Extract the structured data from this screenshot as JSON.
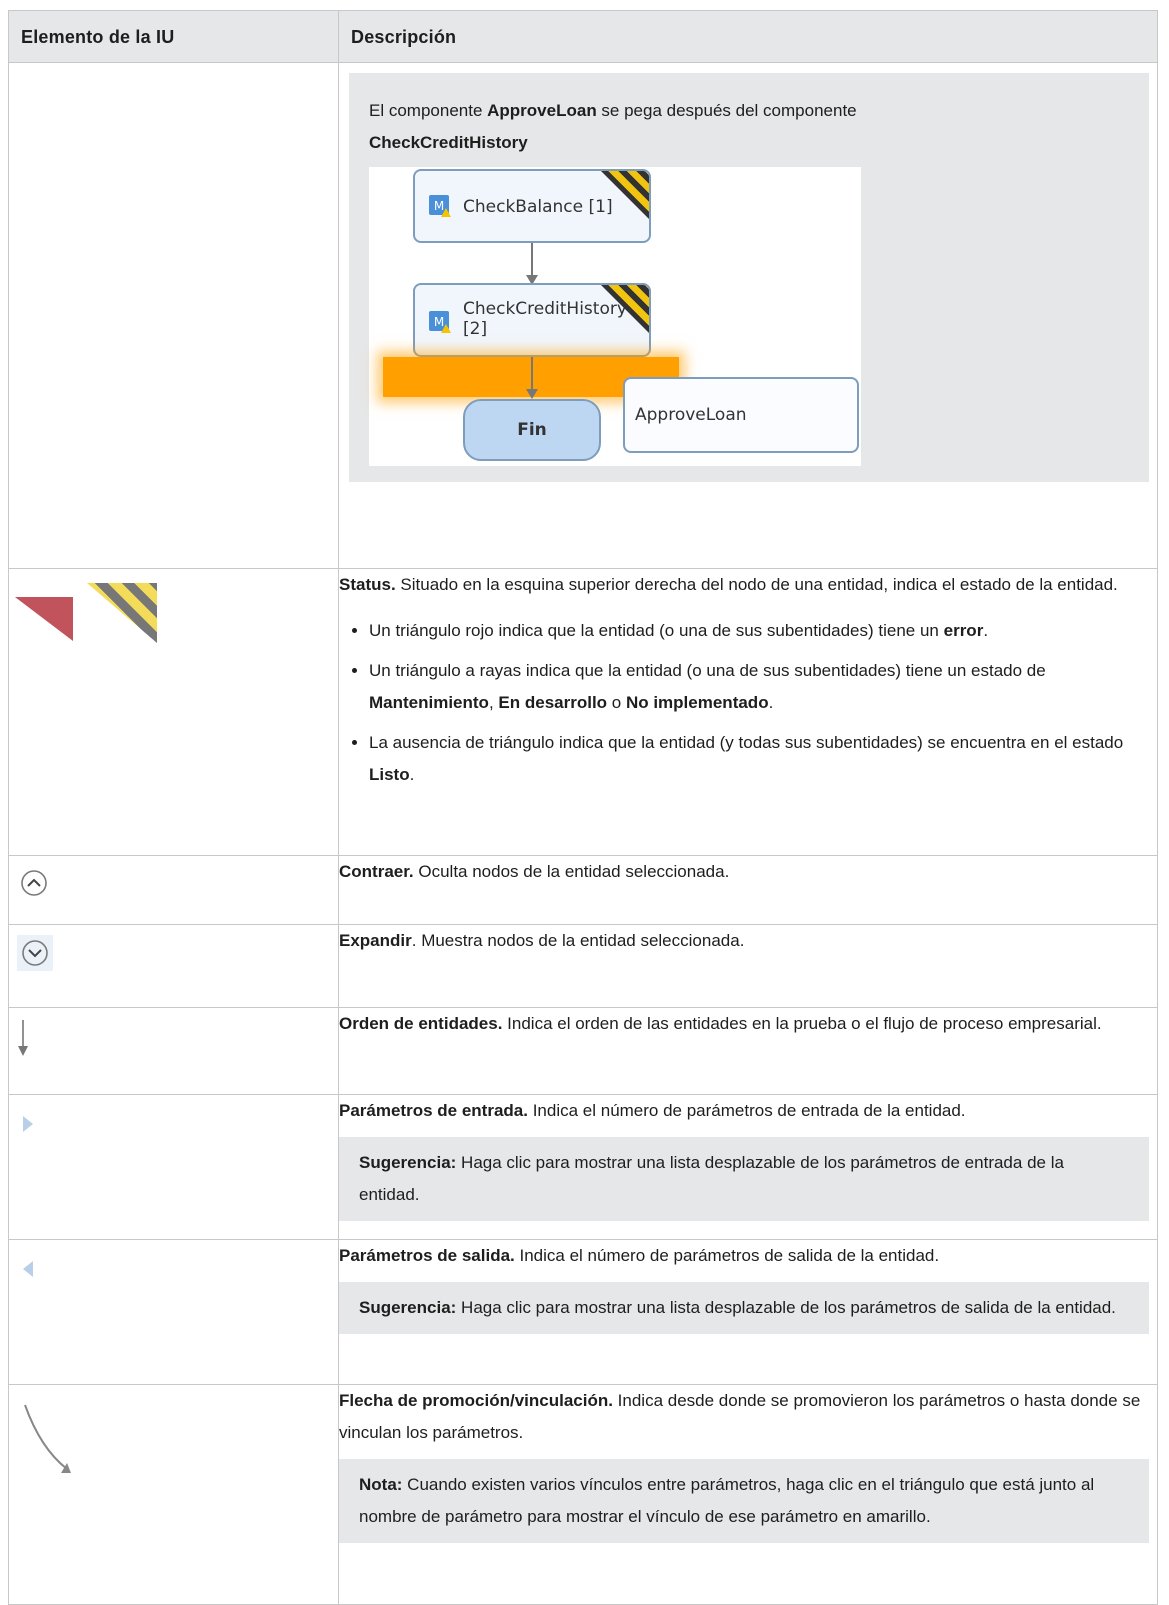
{
  "header": {
    "col1": "Elemento de la IU",
    "col2": "Descripción"
  },
  "row1": {
    "intro_pre": "El componente ",
    "intro_bold1": "ApproveLoan",
    "intro_mid": " se pega después del componente",
    "intro_bold2": "CheckCreditHistory",
    "diagram": {
      "node1": "CheckBalance [1]",
      "node2_line1": "CheckCreditHistory",
      "node2_line2": "[2]",
      "end": "Fin",
      "pasted": "ApproveLoan"
    }
  },
  "status": {
    "title": "Status.",
    "text": " Situado en la esquina superior derecha del nodo de una entidad, indica el estado de la entidad.",
    "b1_pre": "Un triángulo rojo indica que la entidad (o una de sus subentidades) tiene un ",
    "b1_bold": "error",
    "b1_post": ".",
    "b2_pre": "Un triángulo a rayas indica que la entidad (o una de sus subentidades) tiene un estado de ",
    "b2_bold1": "Mantenimiento",
    "b2_sep1": ", ",
    "b2_bold2": "En desarrollo",
    "b2_sep2": " o ",
    "b2_bold3": "No implementado",
    "b2_post": ".",
    "b3_pre": "La ausencia de triángulo indica que la entidad (y todas sus subentidades) se encuentra en el estado ",
    "b3_bold": "Listo",
    "b3_post": "."
  },
  "collapse": {
    "title": "Contraer.",
    "text": " Oculta nodos de la entidad seleccionada."
  },
  "expand": {
    "title": "Expandir",
    "text": ". Muestra nodos de la entidad seleccionada."
  },
  "order": {
    "title": "Orden de entidades.",
    "text": " Indica el orden de las entidades en la prueba o el flujo de proceso empresarial."
  },
  "input": {
    "title": "Parámetros de entrada.",
    "text": " Indica el número de parámetros de entrada de la entidad.",
    "tip_label": "Sugerencia:",
    "tip_text": " Haga clic para mostrar una lista desplazable de los parámetros de entrada de la entidad."
  },
  "output": {
    "title": "Parámetros de salida.",
    "text": " Indica el número de parámetros de salida de la entidad.",
    "tip_label": "Sugerencia:",
    "tip_text": " Haga clic para mostrar una lista desplazable de los parámetros de salida de la entidad."
  },
  "link": {
    "title": "Flecha de promoción/vinculación.",
    "text": " Indica desde donde se promovieron los parámetros o hasta donde se vinculan los parámetros.",
    "note_label": "Nota:",
    "note_text": " Cuando existen varios vínculos entre parámetros, haga clic en el triángulo que está junto al nombre de parámetro para mostrar el vínculo de ese parámetro en amarillo."
  }
}
